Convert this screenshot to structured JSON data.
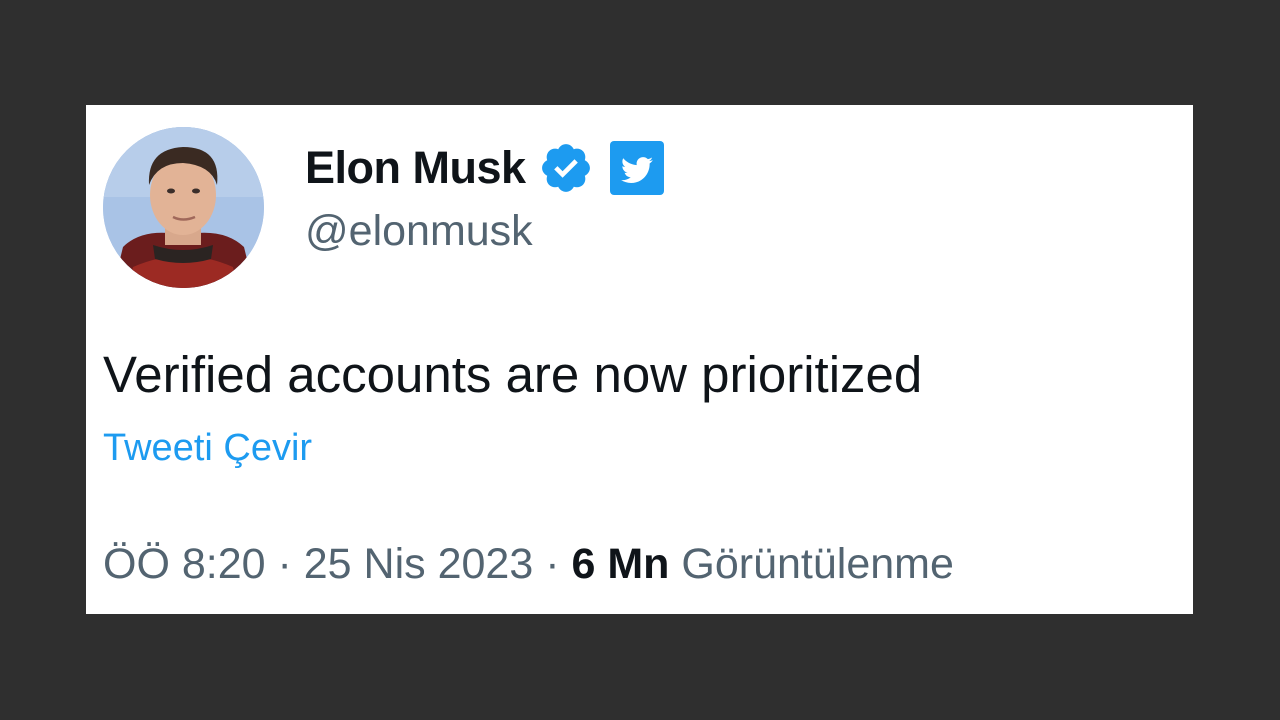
{
  "tweet": {
    "author": {
      "display_name": "Elon Musk",
      "handle": "@elonmusk",
      "verified": true
    },
    "text": "Verified accounts are now prioritized",
    "translate_label": "Tweeti Çevir",
    "meta": {
      "time": "ÖÖ 8:20",
      "separator": "·",
      "date": "25 Nis 2023",
      "views_count": "6 Mn",
      "views_label": "Görüntülenme"
    }
  },
  "icons": {
    "verified": "verified-badge-icon",
    "logo": "twitter-bird-icon"
  },
  "colors": {
    "background": "#2f2f2f",
    "card": "#ffffff",
    "accent_blue": "#1d9bf0",
    "primary_text": "#0f1419",
    "secondary_text": "#536471"
  }
}
